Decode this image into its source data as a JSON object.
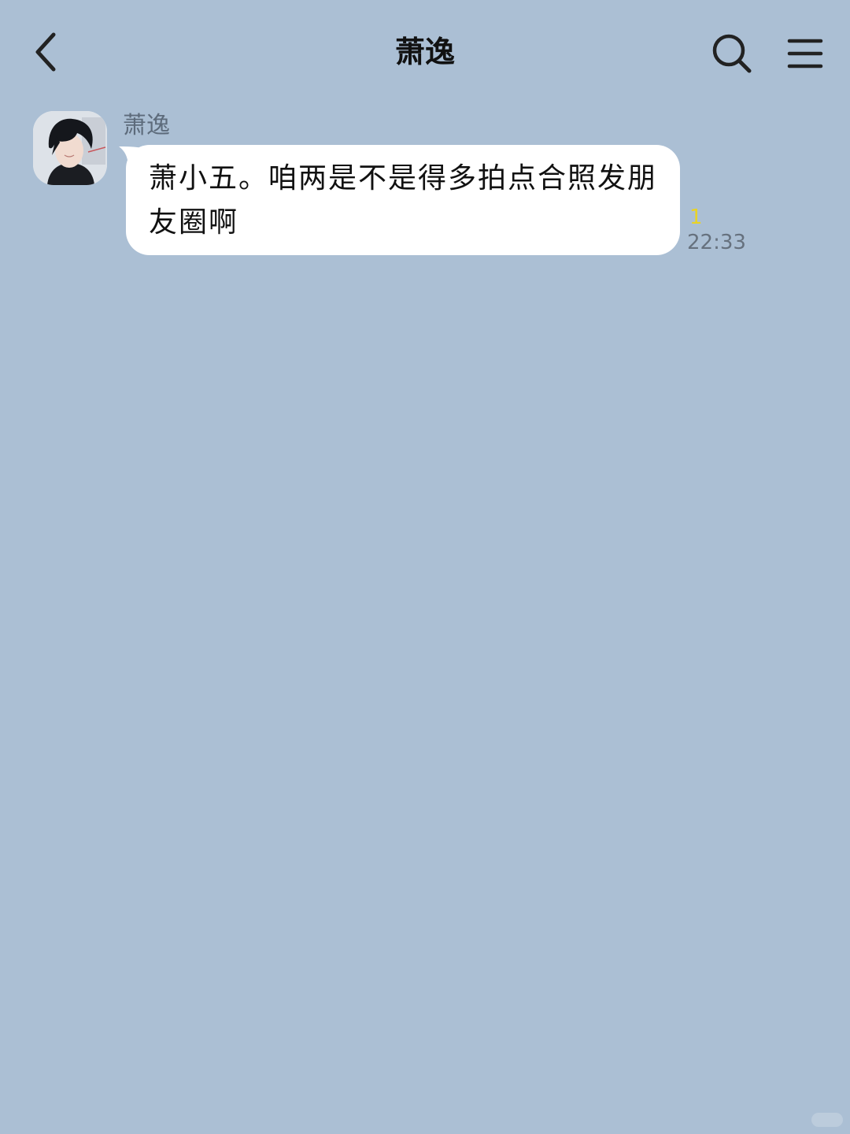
{
  "header": {
    "back_icon": "chevron-left-icon",
    "title": "萧逸",
    "search_icon": "search-icon",
    "menu_icon": "hamburger-menu-icon"
  },
  "messages": [
    {
      "sender": "萧逸",
      "avatar": "avatar-dark-haired-man",
      "text": "萧小五。咱两是不是得多拍点合照发朋友圈啊",
      "read_count": "1",
      "time": "22:33"
    }
  ],
  "colors": {
    "background": "#abbfd4",
    "bubble": "#ffffff",
    "read_count": "#e9d325",
    "time": "#66717e",
    "sender_name": "#5d6b7b"
  }
}
